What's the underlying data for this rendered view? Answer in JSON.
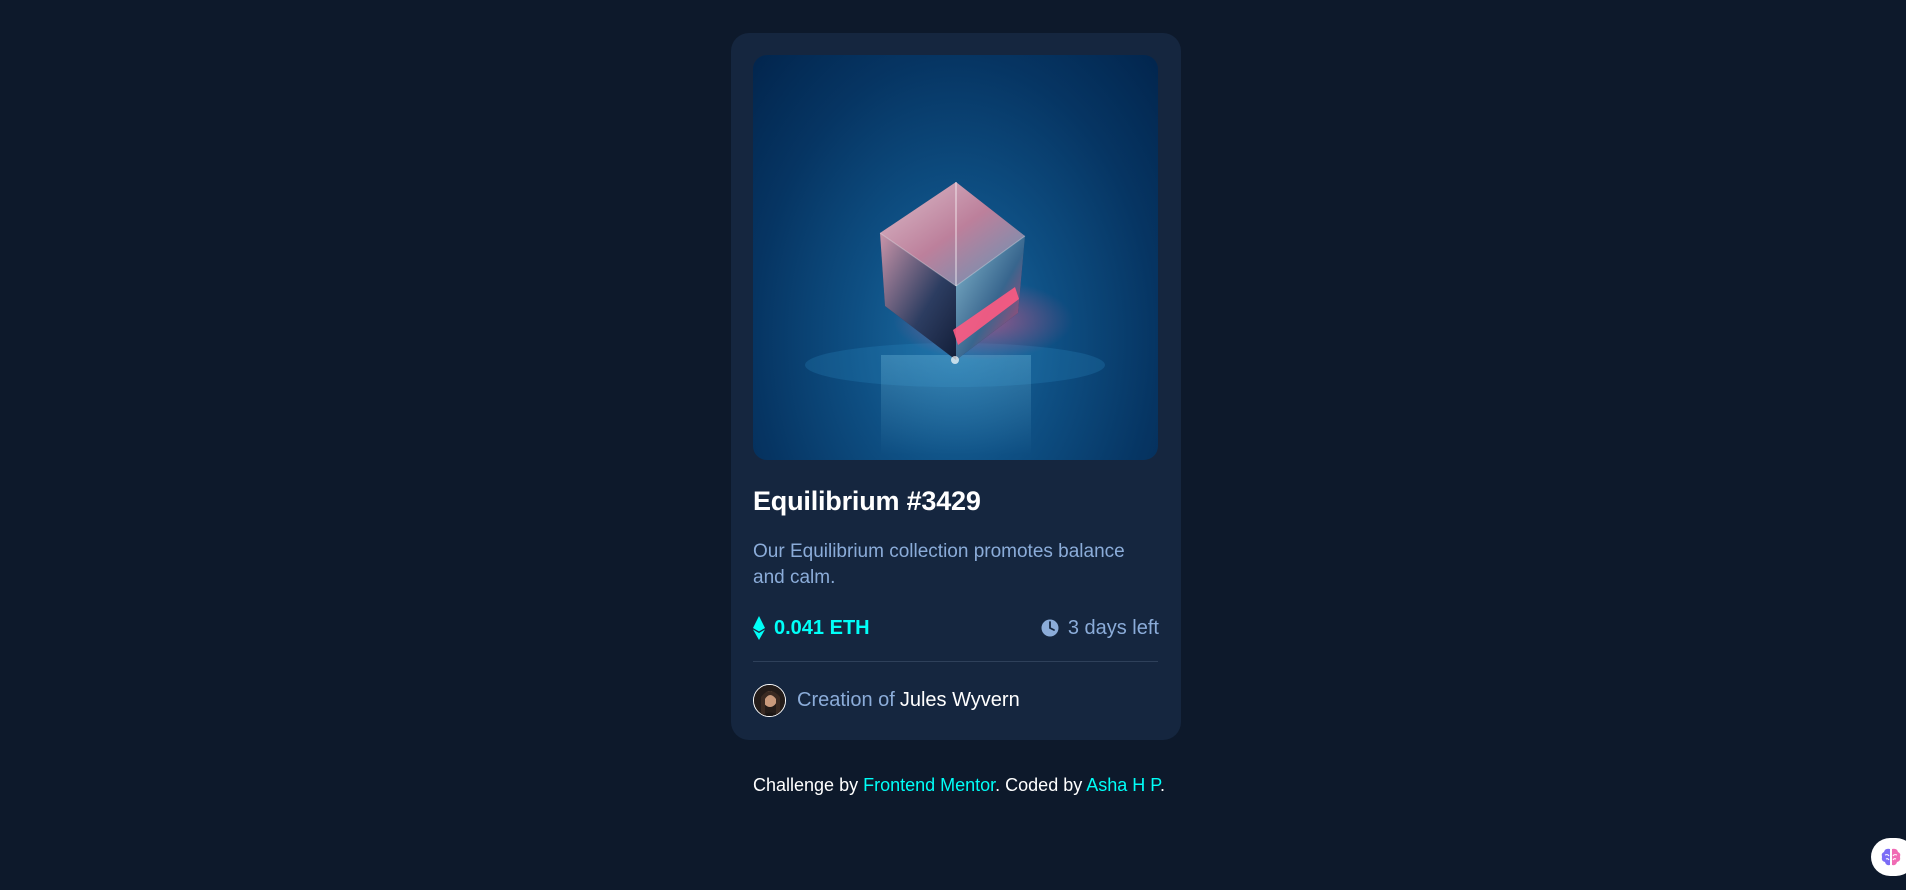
{
  "card": {
    "title": "Equilibrium #3429",
    "description": "Our Equilibrium collection promotes balance and calm.",
    "price": "0.041 ETH",
    "time_left": "3 days left",
    "creator_prefix": "Creation of",
    "creator_name": "Jules Wyvern"
  },
  "footer": {
    "text_1": "Challenge by ",
    "link_1": "Frontend Mentor",
    "text_2": ". Coded by ",
    "link_2": "Asha H P",
    "text_3": "."
  },
  "colors": {
    "background": "#0d192b",
    "card": "#15263f",
    "accent_cyan": "#00fff8",
    "soft_blue": "#8bacd9",
    "white": "#ffffff"
  },
  "icons": {
    "price": "ethereum-icon",
    "time": "clock-icon",
    "widget": "brain-icon"
  }
}
